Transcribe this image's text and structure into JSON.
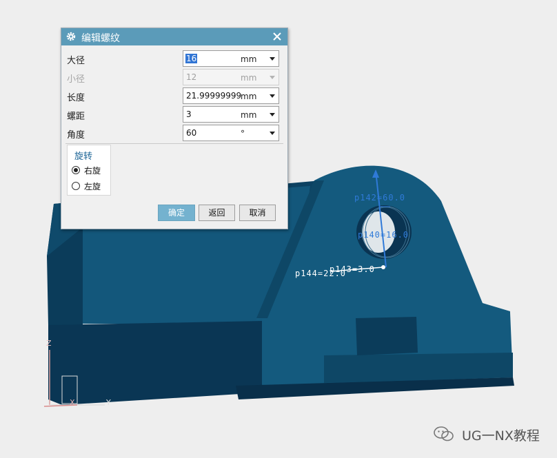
{
  "dialog": {
    "title": "编辑螺纹",
    "fields": [
      {
        "label": "大径",
        "value": "16",
        "unit": "mm",
        "enabled": true,
        "selected": true
      },
      {
        "label": "小径",
        "value": "12",
        "unit": "mm",
        "enabled": false,
        "selected": false
      },
      {
        "label": "长度",
        "value": "21.99999999",
        "unit": "mm",
        "enabled": true,
        "selected": false
      },
      {
        "label": "螺距",
        "value": "3",
        "unit": "mm",
        "enabled": true,
        "selected": false
      },
      {
        "label": "角度",
        "value": "60",
        "unit": "°",
        "enabled": true,
        "selected": false
      }
    ],
    "rotation": {
      "title": "旋转",
      "options": [
        {
          "label": "右旋",
          "checked": true
        },
        {
          "label": "左旋",
          "checked": false
        }
      ]
    },
    "buttons": {
      "ok": "确定",
      "back": "返回",
      "cancel": "取消"
    }
  },
  "viewport": {
    "annotations": [
      "p142=60.0",
      "p140=16.0",
      "p144=22.0",
      "p143=3.0"
    ],
    "axes": {
      "z": "Z",
      "x": "X",
      "y": "Y"
    }
  },
  "watermark": "UG一NX教程",
  "colors": {
    "title_bar": "#5b9bb9",
    "primary_button": "#74b2cf",
    "model_face": "#145a7e",
    "model_dark": "#0c3f5d",
    "annotation": "#2f7ad8"
  }
}
